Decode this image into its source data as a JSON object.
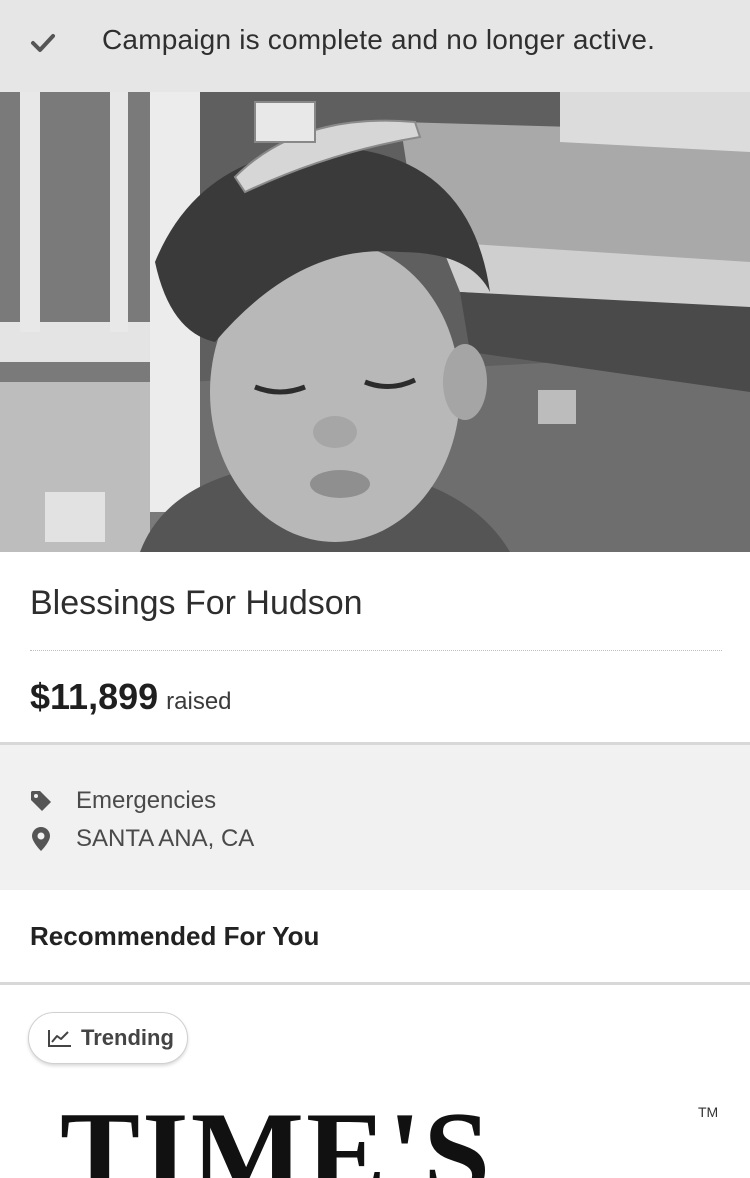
{
  "banner": {
    "icon": "checkmark-icon",
    "text": "Campaign is complete and no longer active."
  },
  "campaign": {
    "title": "Blessings For Hudson",
    "amount": "$11,899",
    "amount_label": "raised",
    "category_icon": "tag-icon",
    "category": "Emergencies",
    "location_icon": "map-pin-icon",
    "location": "SANTA ANA, CA"
  },
  "recommended": {
    "title": "Recommended For You",
    "badge_icon": "trending-chart-icon",
    "badge_label": "Trending",
    "card_heading": "TIME'S",
    "card_trademark": "TM"
  }
}
